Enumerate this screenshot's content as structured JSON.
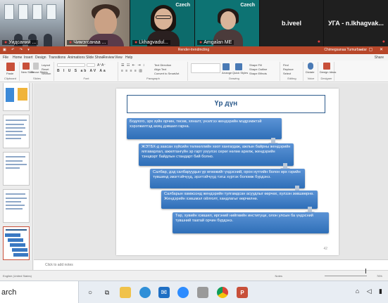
{
  "zoom": {
    "tiles": [
      {
        "name": "Уидсаний ..."
      },
      {
        "name": "Чимэгсанаа ..."
      },
      {
        "name": "Lkhagvadul...",
        "brand": "Czech"
      },
      {
        "name": "Amgalan ME",
        "brand": "Czech"
      },
      {
        "name": "b.iveel"
      },
      {
        "name": "УГА - n.lkhagvak..."
      }
    ]
  },
  "ppt": {
    "title": "Render-trendmcting",
    "user": "Chimegsanaa Tumurbaatar",
    "menu": [
      "File",
      "Home",
      "Insert",
      "Design",
      "Transitions",
      "Animations",
      "Slide Show",
      "Review",
      "View",
      "Help"
    ],
    "share": "Share",
    "ribbon_groups": [
      "Clipboard",
      "Slides",
      "Font",
      "Paragraph",
      "Drawing",
      "Editing",
      "Voice",
      "Designer"
    ],
    "ribbon_labels": {
      "paste": "Paste",
      "new_slide": "New Slide",
      "reuse_slides": "Reuse Slides",
      "layout": "Layout",
      "reset": "Reset",
      "section": "Section",
      "text_direction": "Text Direction",
      "align_text": "Align Text",
      "convert": "Convert to SmartArt",
      "arrange": "Arrange",
      "quick_styles": "Quick Styles",
      "shape_fill": "Shape Fill",
      "shape_outline": "Shape Outline",
      "shape_effects": "Shape Effects",
      "find": "Find",
      "replace": "Replace",
      "select": "Select",
      "dictate": "Dictate",
      "design_ideas": "Design Ideas"
    },
    "slide": {
      "title": "Үр дүн",
      "boxes": [
        "Бодлого, эрх зүйн орчин, төсөв, хяналт, үнэлгээ жендэрийн мэдрэмжтэй хэрэгжилтэд ахиц дэвшил гарна.",
        "ЖЭТБХ-д заасан хүйсийн төлөөллийн хөот хангагдаж, ажлын байрны жендэрийн ялгаварлал, ажилтангүйн эр гарт үзүүлэх серөг нөлөө арилж, жендэрийн тэнцвэрт байдлын стандарт бий болно.",
        "Салбар, дэд салбаруудын үр өгөөжийг үндэсний, орон нутгийн болон өрх гэрийн түвшинд эмэгтэйчүүд, эрэгтэйчүүд тэгш хүртэх боломж бүрдэнэ.",
        "Салбарын хамжээнд жендэрийн тулгамдсан асуудлыг өөрчөх, хүлээн зөвшөөрнө. Жендэрийн хэвшмэл ойлголт, хандлагыг өөрчилнө.",
        "Төр, хувийн хэвшил, иргэний нийгмийн институци, олон улсын ба үндэсний түвшний таатай орчин бүрдэнэ."
      ],
      "number": "42"
    },
    "notes_placeholder": "Click to add notes",
    "status": {
      "language": "English (United States)",
      "notes": "Notes",
      "zoom": "76%"
    }
  },
  "taskbar": {
    "search_text": "arch",
    "icons": [
      "circle-search-icon",
      "task-view-icon",
      "file-explorer-icon",
      "edge-icon",
      "mail-icon",
      "zoom-icon",
      "video-icon",
      "chrome-icon",
      "powerpoint-icon"
    ]
  }
}
